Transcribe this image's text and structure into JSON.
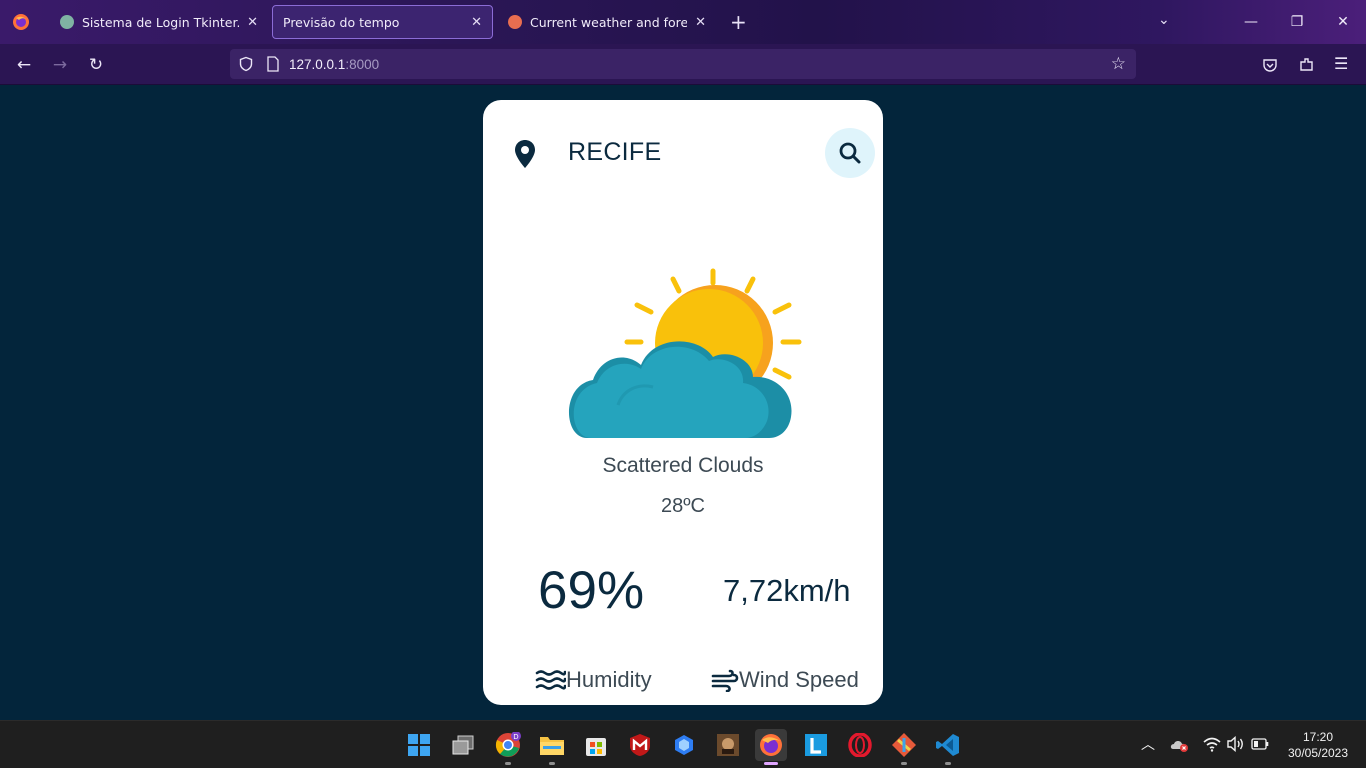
{
  "browser": {
    "tabs": [
      {
        "title": "Sistema de Login Tkinter.",
        "favicon": "openai-favicon",
        "active": false
      },
      {
        "title": "Previsão do tempo",
        "favicon": "none",
        "active": true
      },
      {
        "title": "Current weather and forecast - ",
        "favicon": "openweather-favicon",
        "active": false
      }
    ],
    "url_host": "127.0.0.1",
    "url_port": ":8000",
    "colors": {
      "accent": "#8b6cd6",
      "tabbar": "#2a1655"
    }
  },
  "weather": {
    "city": "RECIFE",
    "description": "Scattered Clouds",
    "temperature": "28ºC",
    "humidity_value": "69%",
    "humidity_label": "Humidity",
    "wind_value": "7,72km/h",
    "wind_label": "Wind Speed",
    "colors": {
      "page_bg": "#03253b",
      "card_bg": "#ffffff",
      "text_dark": "#0b2a3f",
      "sun": "#f9c10b",
      "cloud": "#25a4bd"
    }
  },
  "taskbar": {
    "apps": [
      "windows-start-icon",
      "task-view-icon",
      "chrome-icon",
      "file-explorer-icon",
      "microsoft-store-icon",
      "mcafee-icon",
      "bing-icon",
      "game-icon",
      "firefox-icon",
      "l-app-icon",
      "opera-icon",
      "git-icon",
      "vscode-icon"
    ],
    "time": "17:20",
    "date": "30/05/2023"
  }
}
